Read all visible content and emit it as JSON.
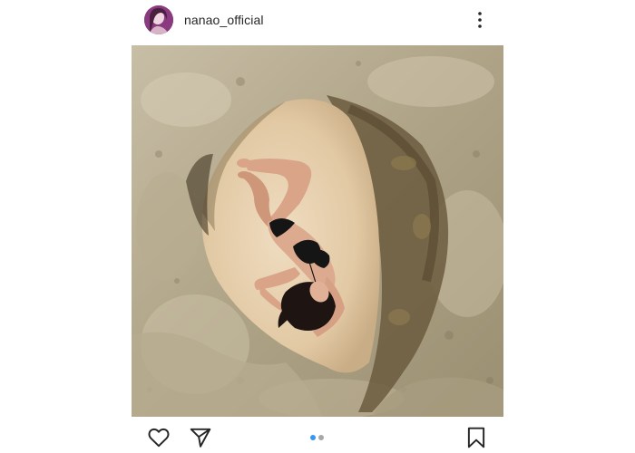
{
  "post": {
    "username": "nanao_official",
    "carousel": {
      "total": 2,
      "active_index": 0
    }
  },
  "icons": {
    "more": "more-vertical-icon",
    "like": "heart-icon",
    "share": "paper-plane-icon",
    "save": "bookmark-icon"
  },
  "colors": {
    "text": "#262626",
    "dot_active": "#3897f0",
    "dot_inactive": "#a8a8a8"
  }
}
